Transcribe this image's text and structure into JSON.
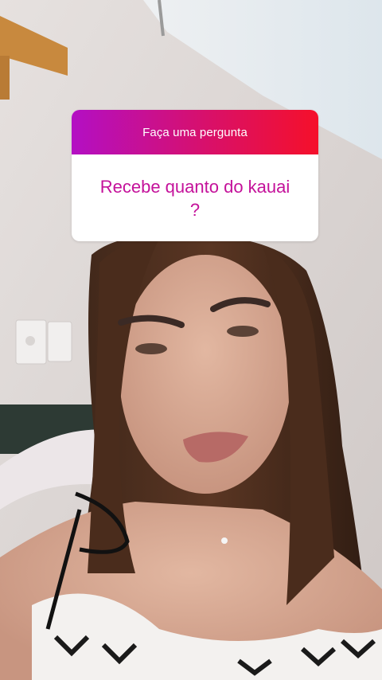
{
  "story": {
    "background_description_icon": "selfie-photo",
    "question_sticker": {
      "title": "Faça uma pergunta",
      "question": "Recebe quanto do kauai ?",
      "header_gradient": [
        "#b30fc4",
        "#d8106a",
        "#f5102a"
      ],
      "question_color": "#c4119a"
    }
  }
}
